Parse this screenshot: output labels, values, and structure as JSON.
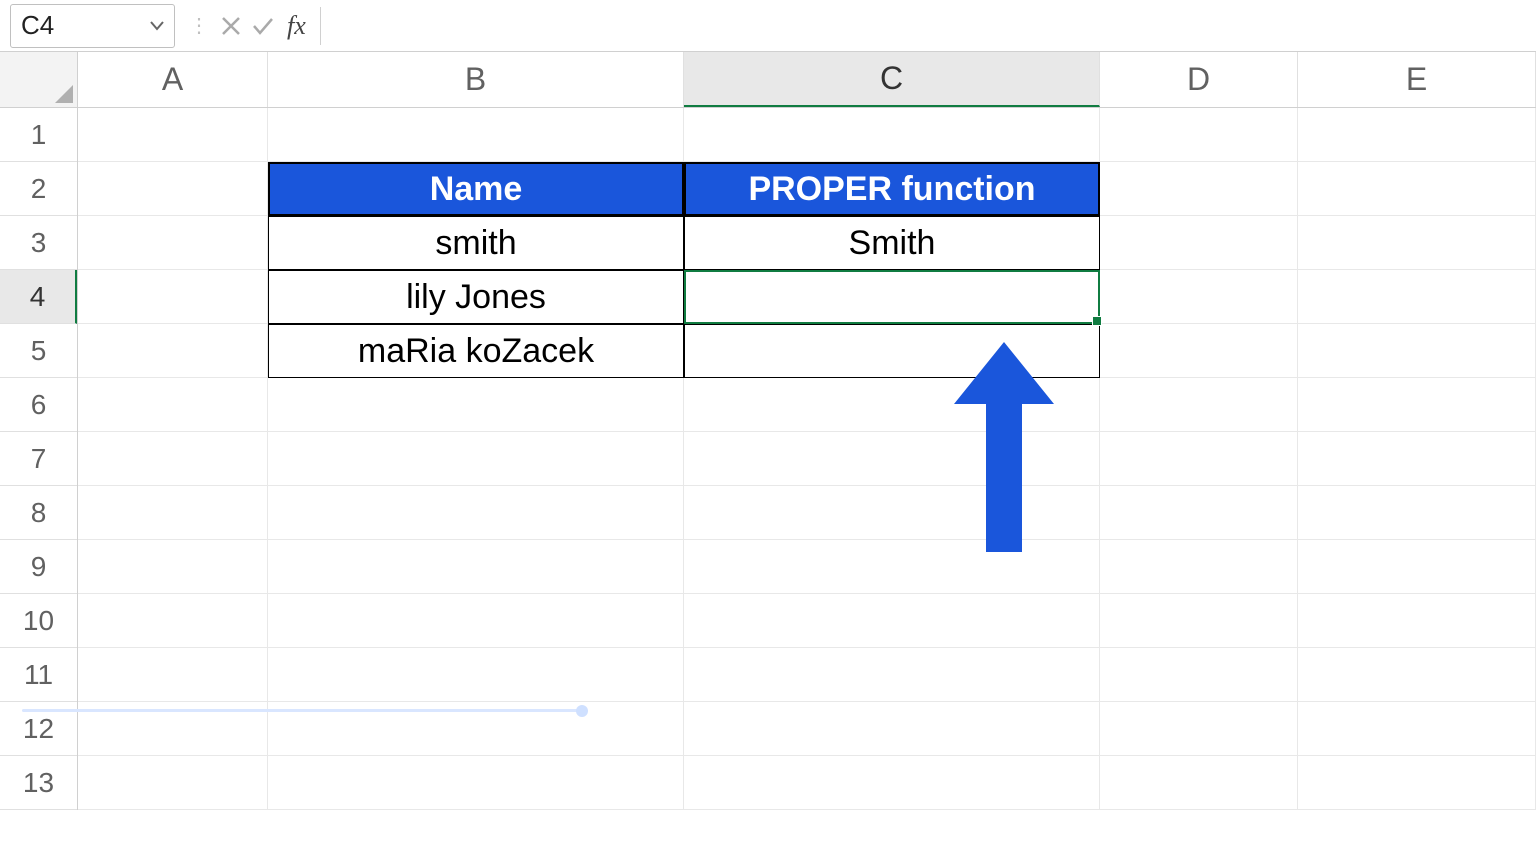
{
  "formula_bar": {
    "name_box": "C4",
    "fx_label": "fx",
    "formula": ""
  },
  "columns": [
    "A",
    "B",
    "C",
    "D",
    "E"
  ],
  "rows": [
    "1",
    "2",
    "3",
    "4",
    "5",
    "6",
    "7",
    "8",
    "9",
    "10",
    "11",
    "12",
    "13"
  ],
  "selected_cell": {
    "col": "C",
    "row": 4
  },
  "table": {
    "headers": {
      "B": "Name",
      "C": "PROPER function"
    },
    "rows": [
      {
        "B": "smith",
        "C": "Smith"
      },
      {
        "B": "lily Jones",
        "C": ""
      },
      {
        "B": "maRia koZacek",
        "C": ""
      }
    ]
  },
  "colors": {
    "header_bg": "#1a56db",
    "selection": "#107c41",
    "arrow": "#1a56db"
  }
}
